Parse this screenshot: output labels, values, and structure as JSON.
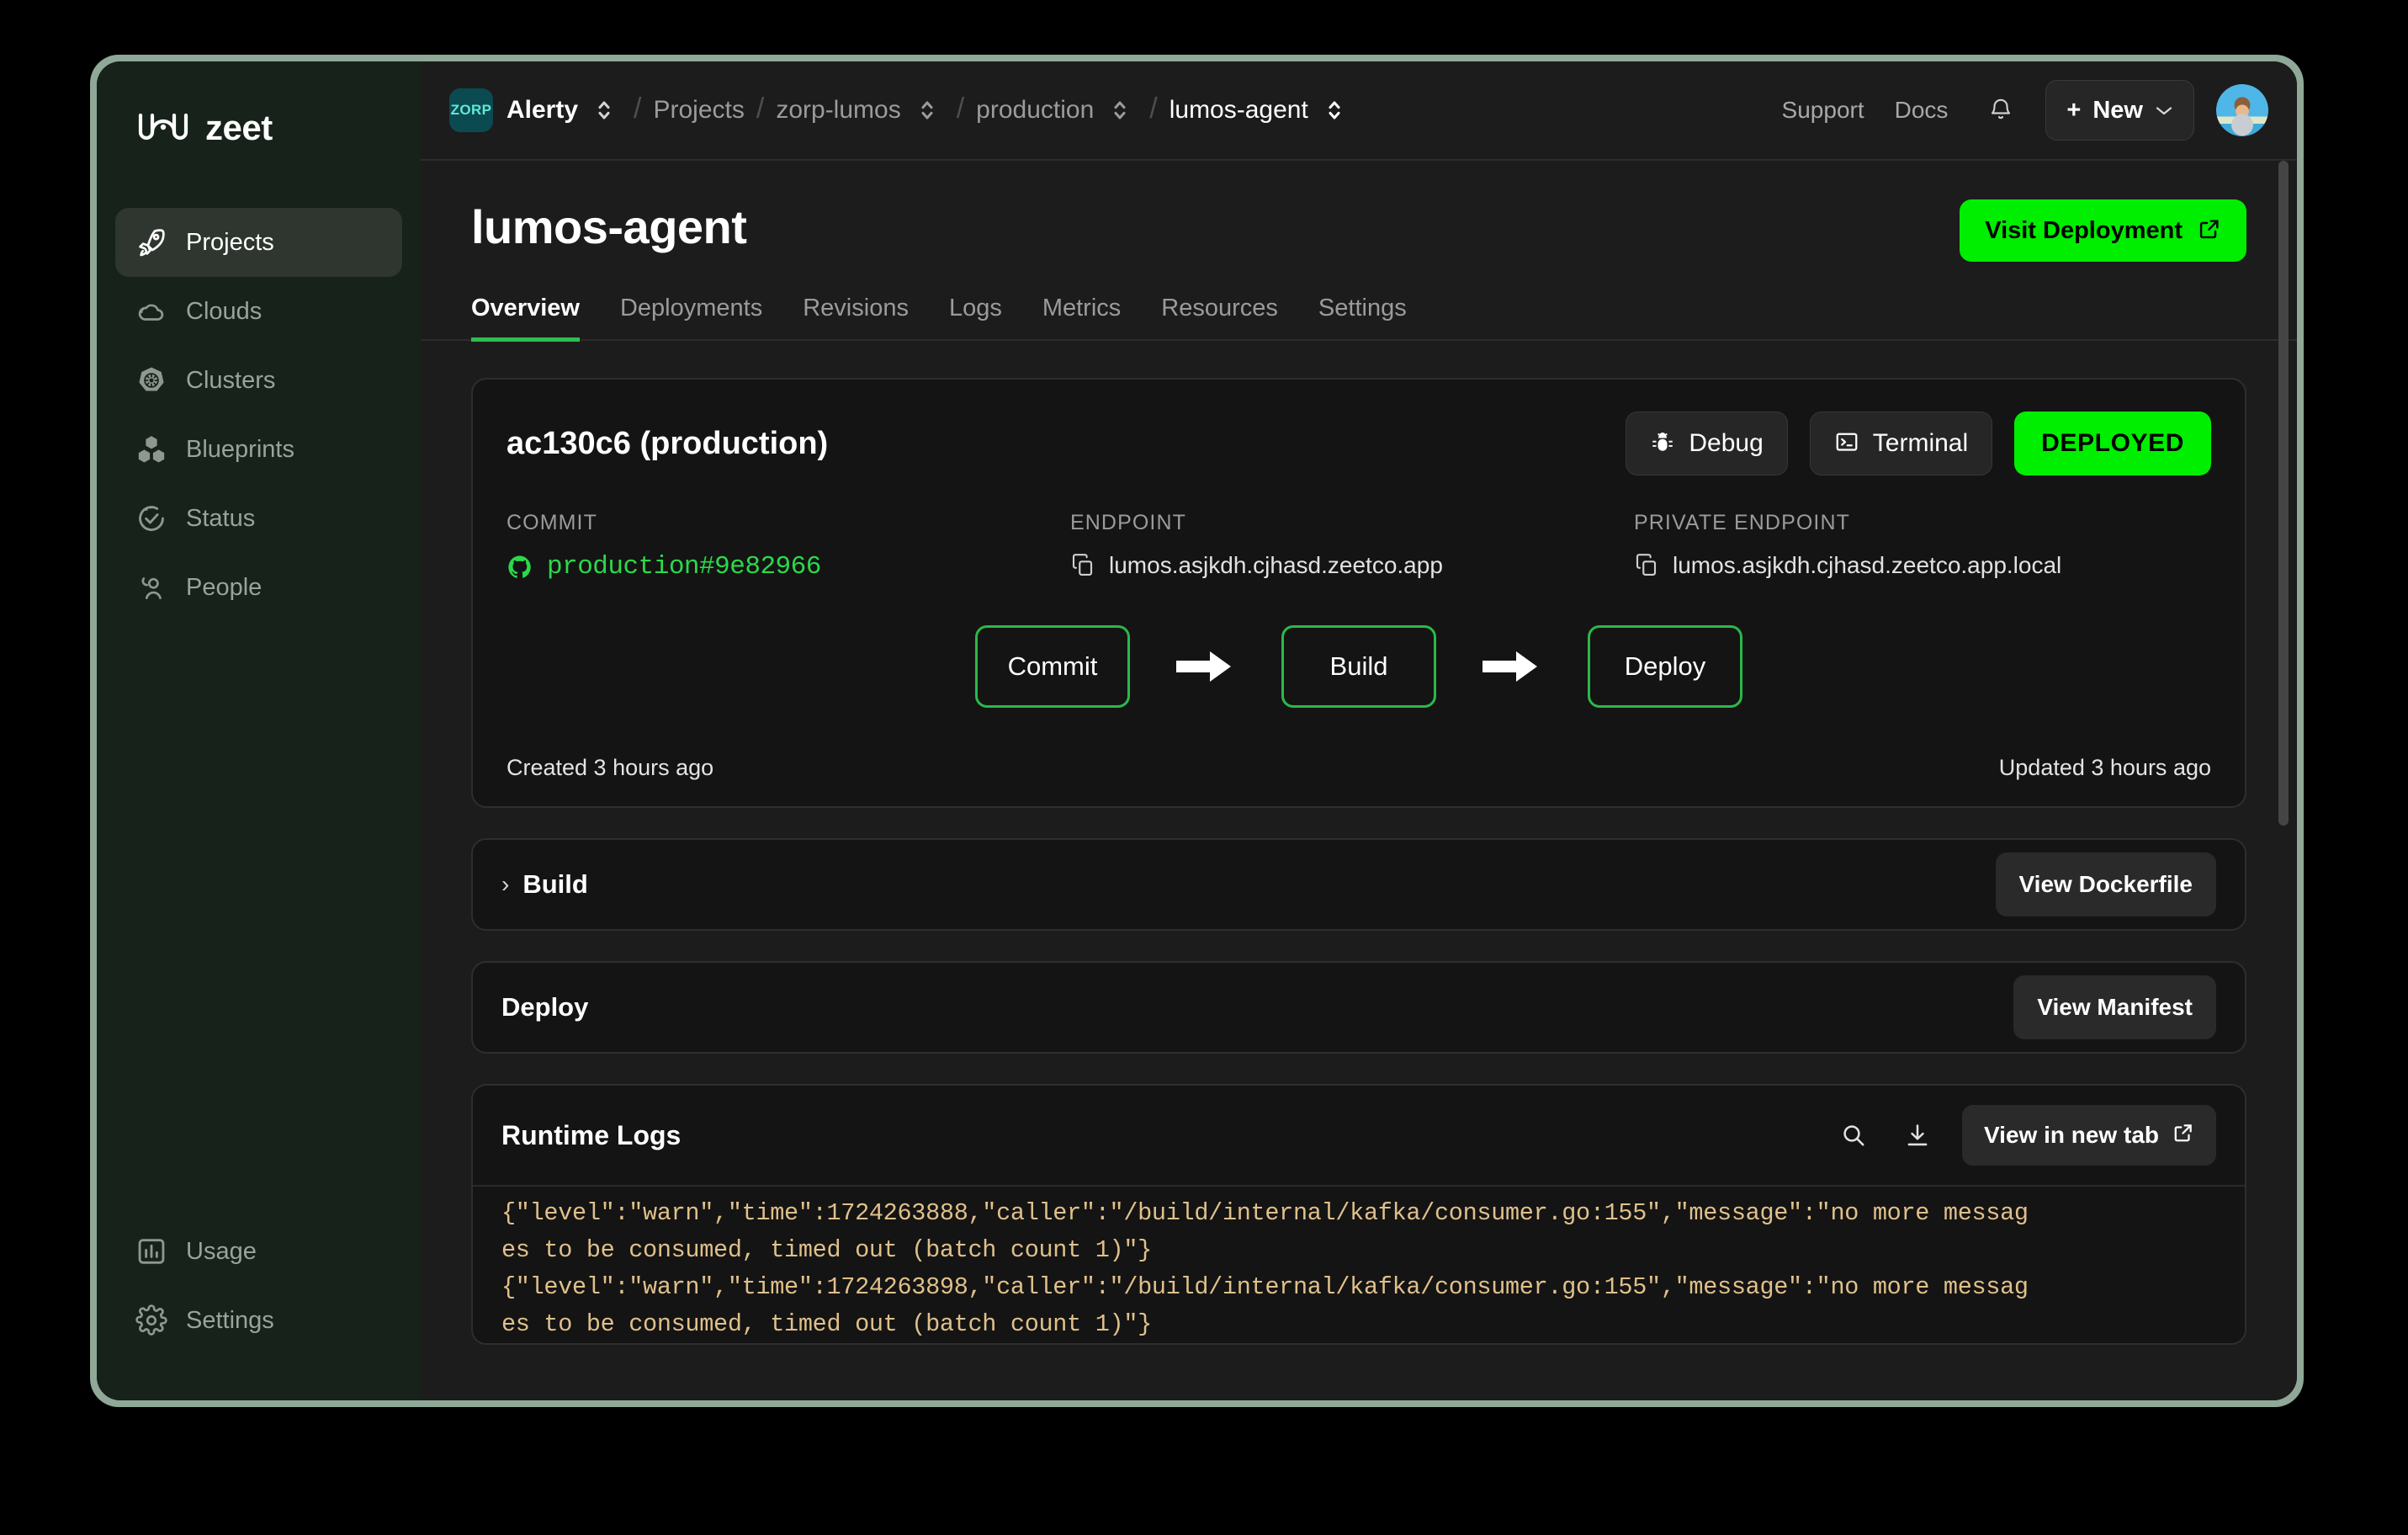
{
  "brand": {
    "name": "zeet",
    "logo_icon": "zeet-logo-icon"
  },
  "sidebar": {
    "primary_items": [
      {
        "label": "Projects",
        "icon": "rocket-icon",
        "active": true
      },
      {
        "label": "Clouds",
        "icon": "cloud-icon",
        "active": false
      },
      {
        "label": "Clusters",
        "icon": "kubernetes-helm-icon",
        "active": false
      },
      {
        "label": "Blueprints",
        "icon": "blocks-icon",
        "active": false
      },
      {
        "label": "Status",
        "icon": "check-circle-icon",
        "active": false
      },
      {
        "label": "People",
        "icon": "people-icon",
        "active": false
      }
    ],
    "secondary_items": [
      {
        "label": "Usage",
        "icon": "bar-chart-icon",
        "active": false
      },
      {
        "label": "Settings",
        "icon": "gear-icon",
        "active": false
      }
    ]
  },
  "topbar": {
    "org_badge": "ZORP",
    "org_name": "Alerty",
    "breadcrumb": [
      {
        "label": "Projects",
        "has_switcher": false,
        "highlight": false
      },
      {
        "label": "zorp-lumos",
        "has_switcher": true,
        "highlight": false
      },
      {
        "label": "production",
        "has_switcher": true,
        "highlight": false
      },
      {
        "label": "lumos-agent",
        "has_switcher": true,
        "highlight": true
      }
    ],
    "separator": "/",
    "support_label": "Support",
    "docs_label": "Docs",
    "bell_icon": "bell-icon",
    "new_button": {
      "label": "New",
      "plus": "+",
      "chevron": "chevron-down-icon"
    },
    "avatar_icon": "user-avatar"
  },
  "page": {
    "title": "lumos-agent",
    "visit_button": {
      "label": "Visit Deployment",
      "icon": "external-link-icon"
    },
    "tabs": [
      {
        "label": "Overview",
        "active": true
      },
      {
        "label": "Deployments",
        "active": false
      },
      {
        "label": "Revisions",
        "active": false
      },
      {
        "label": "Logs",
        "active": false
      },
      {
        "label": "Metrics",
        "active": false
      },
      {
        "label": "Resources",
        "active": false
      },
      {
        "label": "Settings",
        "active": false
      }
    ]
  },
  "deployment": {
    "id_title": "ac130c6 (production)",
    "debug_button": {
      "label": "Debug",
      "icon": "bug-icon"
    },
    "terminal_button": {
      "label": "Terminal",
      "icon": "terminal-icon"
    },
    "status": "DEPLOYED",
    "commit": {
      "label": "COMMIT",
      "icon": "github-icon",
      "branch": "production",
      "hash": "#9e82966"
    },
    "endpoint": {
      "label": "ENDPOINT",
      "icon": "copy-icon",
      "value": "lumos.asjkdh.cjhasd.zeetco.app"
    },
    "private_endpoint": {
      "label": "PRIVATE ENDPOINT",
      "icon": "copy-icon",
      "value": "lumos.asjkdh.cjhasd.zeetco.app.local"
    },
    "pipeline": [
      {
        "label": "Commit"
      },
      {
        "label": "Build"
      },
      {
        "label": "Deploy"
      }
    ],
    "pipeline_arrow_icon": "arrow-right-icon",
    "created_text": "Created 3 hours ago",
    "updated_text": "Updated 3 hours ago"
  },
  "build_section": {
    "title": "Build",
    "chevron": "›",
    "button_label": "View Dockerfile"
  },
  "deploy_section": {
    "title": "Deploy",
    "button_label": "View Manifest"
  },
  "runtime_logs": {
    "title": "Runtime Logs",
    "search_icon": "search-icon",
    "download_icon": "download-icon",
    "new_tab_button": {
      "label": "View in new tab",
      "icon": "external-link-icon"
    },
    "lines": [
      "{\"level\":\"warn\",\"time\":1724263888,\"caller\":\"/build/internal/kafka/consumer.go:155\",\"message\":\"no more messag",
      "es to be consumed, timed out (batch count 1)\"}",
      "{\"level\":\"warn\",\"time\":1724263898,\"caller\":\"/build/internal/kafka/consumer.go:155\",\"message\":\"no more messag",
      "es to be consumed, timed out (batch count 1)\"}"
    ]
  },
  "colors": {
    "accent_green": "#00ee00",
    "pipeline_green": "#2bb84a",
    "commit_green": "#2bd94a",
    "log_text": "#e0c08a",
    "window_frame": "#8fa897",
    "sidebar_bg": "#16221a",
    "main_bg": "#1c1c1c"
  }
}
